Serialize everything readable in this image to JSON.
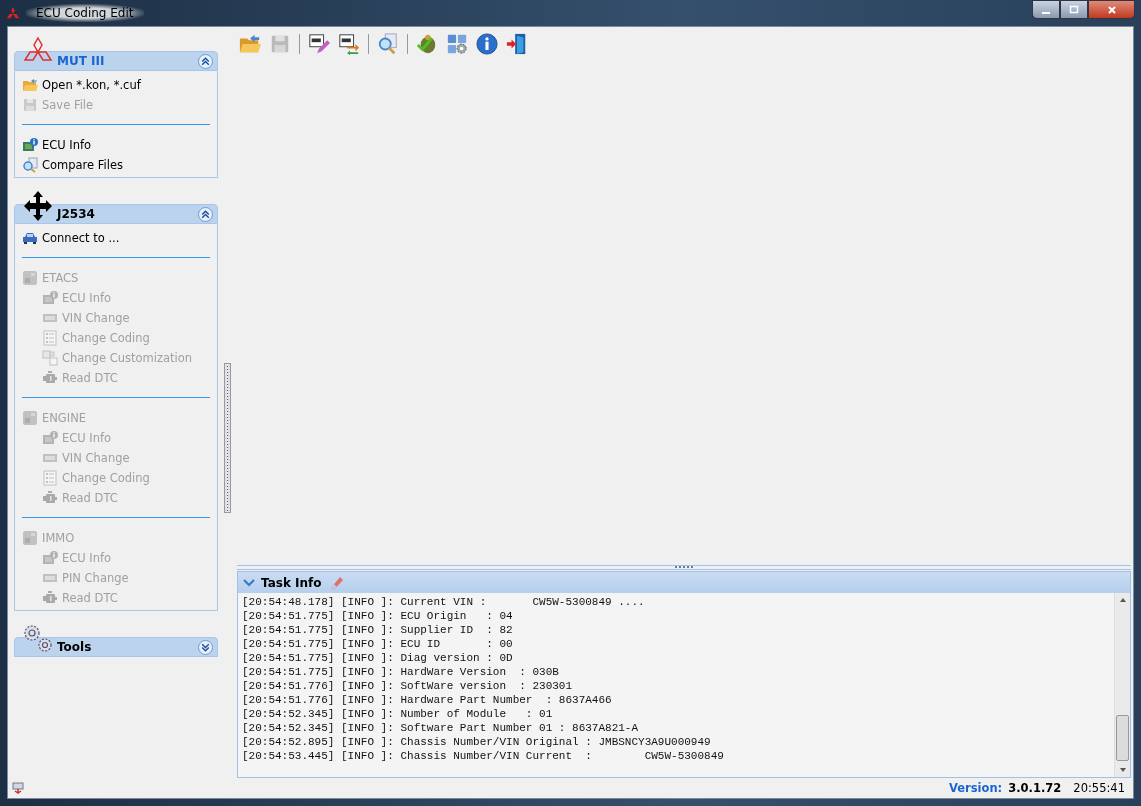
{
  "window": {
    "title": "ECU Coding Edit"
  },
  "toolbar": [
    {
      "kind": "open",
      "disabled": false
    },
    {
      "kind": "save",
      "disabled": true
    },
    {
      "kind": "sep"
    },
    {
      "kind": "ini-edit",
      "disabled": false
    },
    {
      "kind": "ini-swap",
      "disabled": false
    },
    {
      "kind": "sep"
    },
    {
      "kind": "search",
      "disabled": false
    },
    {
      "kind": "sep"
    },
    {
      "kind": "bug",
      "disabled": false
    },
    {
      "kind": "settings",
      "disabled": false
    },
    {
      "kind": "info",
      "disabled": false
    },
    {
      "kind": "exit",
      "disabled": false
    }
  ],
  "sidebar": {
    "panels": [
      {
        "title": "MUT III",
        "kind": "diamonds",
        "expanded": true,
        "sections": [
          [
            {
              "label": "Open *.kon, *.cuf",
              "kind": "folder",
              "disabled": false
            },
            {
              "label": "Save File",
              "kind": "disk",
              "disabled": true
            }
          ],
          [
            {
              "label": "ECU Info",
              "kind": "ecu",
              "disabled": false
            },
            {
              "label": "Compare Files",
              "kind": "compare",
              "disabled": false
            }
          ]
        ]
      },
      {
        "title": "J2534",
        "kind": "arrows",
        "expanded": true,
        "sections": [
          [
            {
              "label": "Connect to ...",
              "kind": "car",
              "disabled": false
            }
          ],
          [
            {
              "label": "ETACS",
              "kind": "module",
              "disabled": true,
              "children": [
                {
                  "label": "ECU Info",
                  "kind": "ecu",
                  "disabled": true
                },
                {
                  "label": "VIN Change",
                  "kind": "card",
                  "disabled": true
                },
                {
                  "label": "Change Coding",
                  "kind": "list",
                  "disabled": true
                },
                {
                  "label": "Change Customization",
                  "kind": "squares",
                  "disabled": true
                },
                {
                  "label": "Read DTC",
                  "kind": "engine",
                  "disabled": true
                }
              ]
            }
          ],
          [
            {
              "label": "ENGINE",
              "kind": "module",
              "disabled": true,
              "children": [
                {
                  "label": "ECU Info",
                  "kind": "ecu",
                  "disabled": true
                },
                {
                  "label": "VIN Change",
                  "kind": "card",
                  "disabled": true
                },
                {
                  "label": "Change Coding",
                  "kind": "list",
                  "disabled": true
                },
                {
                  "label": "Read DTC",
                  "kind": "engine",
                  "disabled": true
                }
              ]
            }
          ],
          [
            {
              "label": "IMMO",
              "kind": "module",
              "disabled": true,
              "children": [
                {
                  "label": "ECU Info",
                  "kind": "ecu",
                  "disabled": true
                },
                {
                  "label": "PIN Change",
                  "kind": "card",
                  "disabled": true
                },
                {
                  "label": "Read DTC",
                  "kind": "engine",
                  "disabled": true
                }
              ]
            }
          ]
        ]
      },
      {
        "title": "Tools",
        "kind": "gears",
        "expanded": false
      }
    ]
  },
  "task_info": {
    "title": "Task Info",
    "expanded": true,
    "lines": [
      "[20:54:48.178] [INFO ]: Current VIN :       CW5W-5300849 ....",
      "[20:54:51.775] [INFO ]: ECU Origin   : 04",
      "[20:54:51.775] [INFO ]: Supplier ID  : 82",
      "[20:54:51.775] [INFO ]: ECU ID       : 00",
      "[20:54:51.775] [INFO ]: Diag version : 0D",
      "[20:54:51.775] [INFO ]: HardWare Version  : 030B",
      "[20:54:51.776] [INFO ]: SoftWare version  : 230301",
      "[20:54:51.776] [INFO ]: Hardware Part Number  : 8637A466",
      "[20:54:52.345] [INFO ]: Number of Module   : 01",
      "[20:54:52.345] [INFO ]: Software Part Number 01 : 8637A821-A",
      "[20:54:52.895] [INFO ]: Chassis Number/VIN Original : JMBSNCY3A9U000949",
      "[20:54:53.445] [INFO ]: Chassis Number/VIN Current  :        CW5W-5300849"
    ]
  },
  "status_bar": {
    "version_label": "Version:",
    "version": "3.0.1.72",
    "time": "20:55:41"
  }
}
